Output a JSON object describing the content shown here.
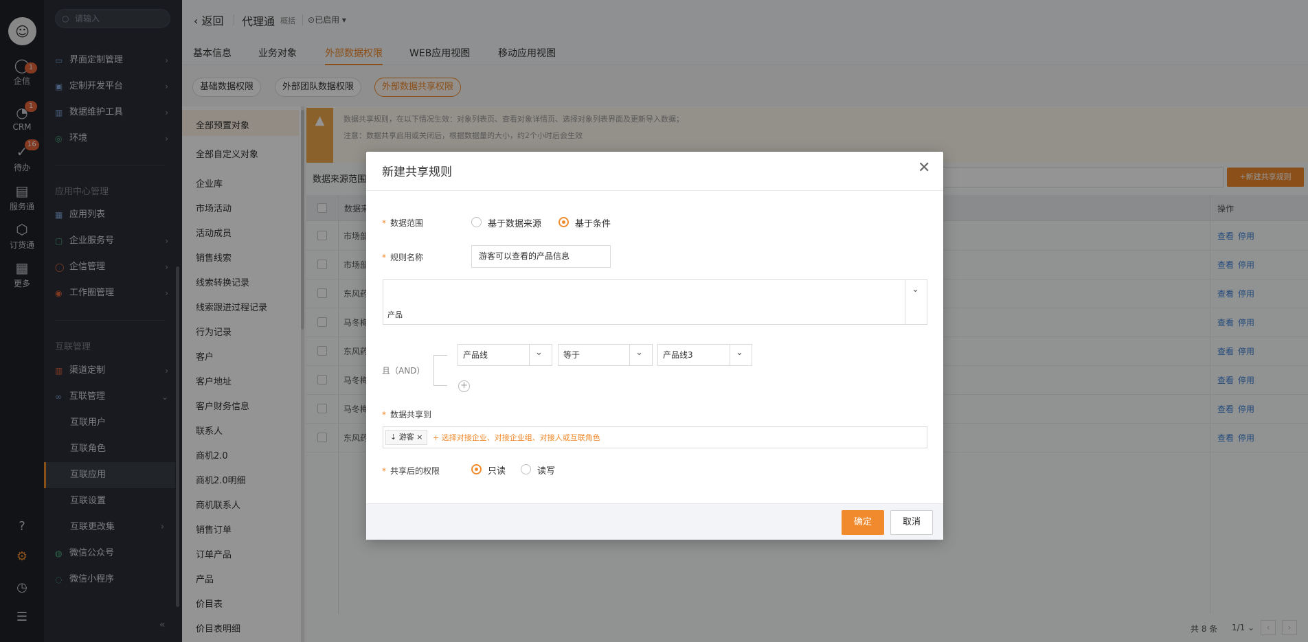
{
  "rail": {
    "items": [
      {
        "label": "企信",
        "icon": "chat-icon",
        "badge": "1"
      },
      {
        "label": "CRM",
        "icon": "crm-icon",
        "badge": "1"
      },
      {
        "label": "待办",
        "icon": "todo-icon",
        "badge": "16"
      },
      {
        "label": "服务通",
        "icon": "service-icon",
        "badge": ""
      },
      {
        "label": "订货通",
        "icon": "order-icon",
        "badge": ""
      },
      {
        "label": "更多",
        "icon": "grid-icon",
        "badge": ""
      }
    ]
  },
  "sidebar": {
    "search_placeholder": "请输入",
    "items": [
      {
        "label": "界面定制管理"
      },
      {
        "label": "定制开发平台"
      },
      {
        "label": "数据维护工具"
      },
      {
        "label": "环境"
      }
    ],
    "section_app": "应用中心管理",
    "app_items": [
      {
        "label": "应用列表"
      },
      {
        "label": "企业服务号"
      },
      {
        "label": "企信管理"
      },
      {
        "label": "工作圈管理"
      }
    ],
    "section_inter": "互联管理",
    "inter_items": [
      {
        "label": "渠道定制"
      },
      {
        "label": "互联管理"
      }
    ],
    "sub_items": [
      {
        "label": "互联用户"
      },
      {
        "label": "互联角色"
      },
      {
        "label": "互联应用"
      },
      {
        "label": "互联设置"
      },
      {
        "label": "互联更改集"
      }
    ],
    "bottom_items": [
      {
        "label": "微信公众号"
      },
      {
        "label": "微信小程序"
      }
    ],
    "collapse": "«"
  },
  "header": {
    "back": "返回",
    "title": "代理通",
    "overview": "概括",
    "status": "已启用"
  },
  "tabs": [
    "基本信息",
    "业务对象",
    "外部数据权限",
    "WEB应用视图",
    "移动应用视图"
  ],
  "chips": [
    "基础数据权限",
    "外部团队数据权限",
    "外部数据共享权限"
  ],
  "objects": [
    "全部预置对象",
    "全部自定义对象",
    "企业库",
    "市场活动",
    "活动成员",
    "销售线索",
    "线索转换记录",
    "线索跟进过程记录",
    "行为记录",
    "客户",
    "客户地址",
    "客户财务信息",
    "联系人",
    "商机2.0",
    "商机2.0明细",
    "商机联系人",
    "销售订单",
    "订单产品",
    "产品",
    "价目表",
    "价目表明细"
  ],
  "notice": {
    "line1": "数据共享规则，在以下情况生效：对象列表页、查看对象详情页、选择对象列表界面及更新导入数据；",
    "line2": "注意：数据共享启用或关闭后，根据数据量的大小，约2个小时后会生效"
  },
  "table": {
    "source_label": "数据来源范围",
    "new_rule": "+新建共享规则",
    "col_source": "数据来",
    "col_op": "操作",
    "rows": [
      "市场部",
      "市场部",
      "东风药",
      "马冬梅",
      "东风药",
      "马冬梅",
      "马冬梅",
      "东风药"
    ],
    "row_op_view": "查看",
    "row_op_stop": "停用",
    "total": "共 8 条",
    "page": "1/1"
  },
  "modal": {
    "title": "新建共享规则",
    "scope_label": "数据范围",
    "scope_opt1": "基于数据来源",
    "scope_opt2": "基于条件",
    "name_label": "规则名称",
    "name_value": "游客可以查看的产品信息",
    "object_value": "产品",
    "and_label": "且（AND）",
    "cond_field": "产品线",
    "cond_op": "等于",
    "cond_value": "产品线3",
    "share_label": "数据共享到",
    "share_tag": "游客",
    "share_placeholder": "+ 选择对接企业、对接企业组、对接人或互联角色",
    "perm_label": "共享后的权限",
    "perm_ro": "只读",
    "perm_rw": "读写",
    "ok": "确定",
    "cancel": "取消"
  },
  "colors": {
    "accent": "#f08a2c",
    "link": "#3b7ed4",
    "rail": "#1f2229",
    "sidebar": "#2b2e36"
  }
}
